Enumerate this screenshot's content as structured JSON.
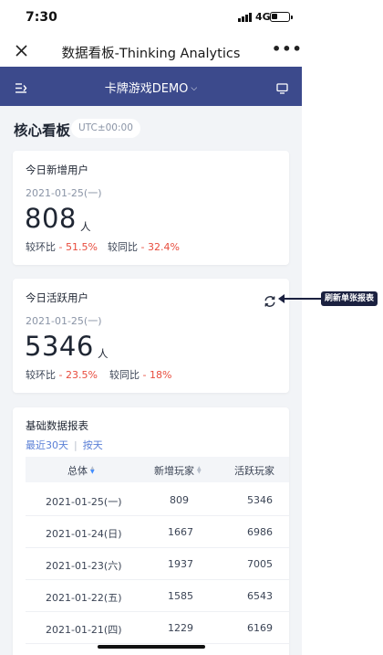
{
  "status": {
    "time": "7:30",
    "network": "4G"
  },
  "titlebar": {
    "title": "数据看板-Thinking Analytics"
  },
  "appbar": {
    "project": "卡牌游戏DEMO"
  },
  "dashboard": {
    "title": "核心看板",
    "timezone": "UTC±00:00"
  },
  "card_new_users": {
    "label": "今日新增用户",
    "date": "2021-01-25(一)",
    "value": "808",
    "unit": "人",
    "mom_label": "较环比",
    "mom_value": "- 51.5%",
    "yoy_label": "较同比",
    "yoy_value": "- 32.4%"
  },
  "card_active_users": {
    "label": "今日活跃用户",
    "date": "2021-01-25(一)",
    "value": "5346",
    "unit": "人",
    "mom_label": "较环比",
    "mom_value": "- 23.5%",
    "yoy_label": "较同比",
    "yoy_value": "- 18%"
  },
  "annotation": {
    "label": "刷新单张报表"
  },
  "report": {
    "title": "基础数据报表",
    "range": "最近30天",
    "granularity": "按天",
    "columns": [
      "总体",
      "新增玩家",
      "活跃玩家"
    ],
    "rows": [
      {
        "date": "2021-01-25(一)",
        "new": "809",
        "active": "5346"
      },
      {
        "date": "2021-01-24(日)",
        "new": "1667",
        "active": "6986"
      },
      {
        "date": "2021-01-23(六)",
        "new": "1937",
        "active": "7005"
      },
      {
        "date": "2021-01-22(五)",
        "new": "1585",
        "active": "6543"
      },
      {
        "date": "2021-01-21(四)",
        "new": "1229",
        "active": "6169"
      }
    ]
  },
  "colors": {
    "header_bg": "#3c4a8c",
    "negative": "#e84c3d",
    "link": "#5a7fd6",
    "annotation_bg": "#1b2140"
  },
  "icons": [
    "close-icon",
    "more-icon",
    "menu-icon",
    "chevron-down-icon",
    "screen-icon",
    "refresh-icon",
    "sort-icon"
  ]
}
